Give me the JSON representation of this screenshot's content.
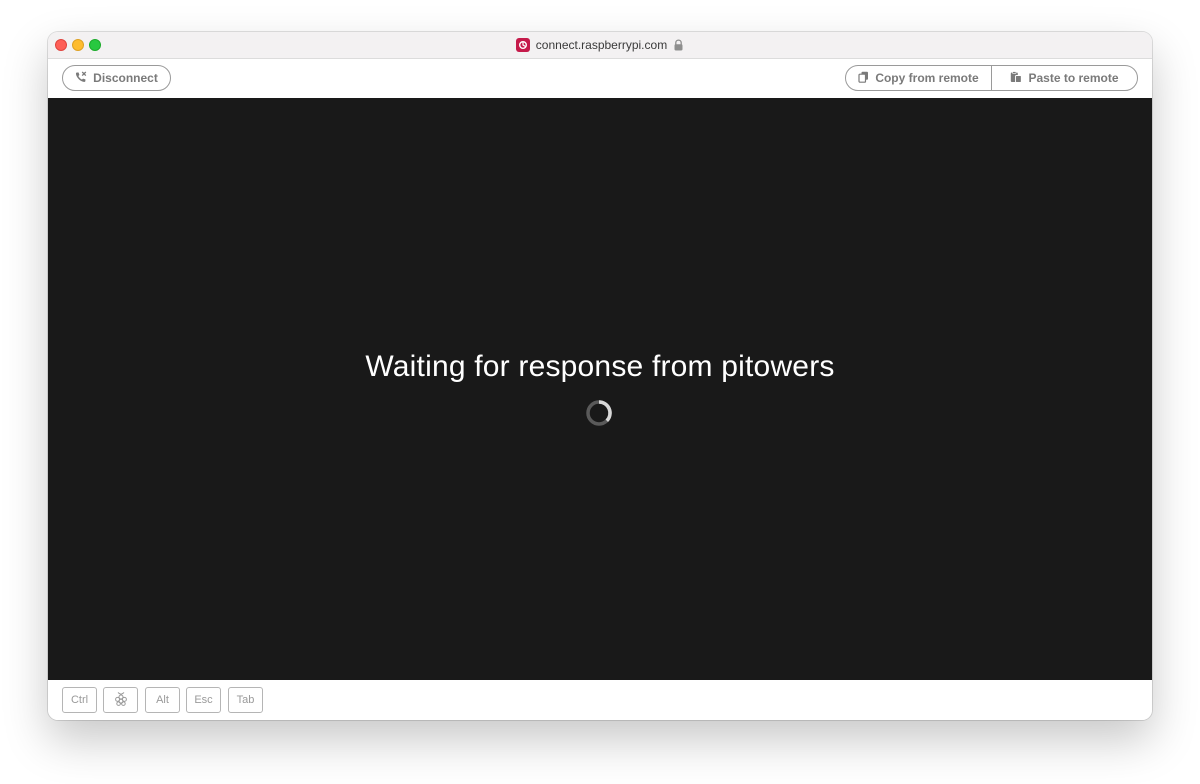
{
  "browser": {
    "url": "connect.raspberrypi.com"
  },
  "toolbar": {
    "disconnect_label": "Disconnect",
    "copy_label": "Copy from remote",
    "paste_label": "Paste to remote"
  },
  "remote": {
    "status_text": "Waiting for response from pitowers"
  },
  "keys": {
    "ctrl": "Ctrl",
    "alt": "Alt",
    "esc": "Esc",
    "tab": "Tab"
  },
  "icons": {
    "favicon": "raspberry-pi-connect-icon",
    "lock": "lock-icon",
    "disconnect": "phone-disconnect-icon",
    "copy": "clipboard-copy-icon",
    "paste": "clipboard-paste-icon",
    "spinner": "loading-spinner-icon",
    "super_key": "raspberry-pi-logo-icon"
  },
  "colors": {
    "remote_background": "#191919",
    "brand": "#c51a4a",
    "button_border": "#9a9a9a"
  }
}
